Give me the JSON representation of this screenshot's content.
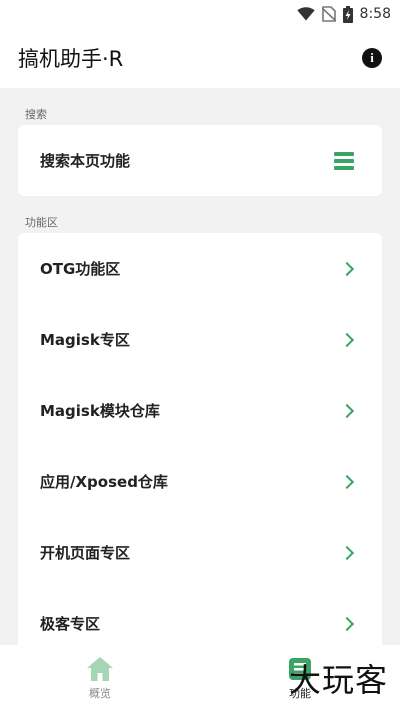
{
  "status_bar": {
    "time": "8:58",
    "icons": [
      "wifi-icon",
      "no-sim-icon",
      "battery-charging-icon"
    ]
  },
  "app_bar": {
    "title": "搞机助手·R",
    "info_icon": "info-icon"
  },
  "search_section": {
    "label": "搜索",
    "item_label": "搜索本页功能",
    "item_icon": "menu-icon"
  },
  "features_section": {
    "label": "功能区",
    "items": [
      {
        "label": "OTG功能区"
      },
      {
        "label": "Magisk专区"
      },
      {
        "label": "Magisk模块仓库"
      },
      {
        "label": "应用/Xposed仓库"
      },
      {
        "label": "开机页面专区"
      },
      {
        "label": "极客专区"
      }
    ]
  },
  "bottom_nav": {
    "items": [
      {
        "label": "概览",
        "icon": "home-icon",
        "active": false
      },
      {
        "label": "功能",
        "icon": "feature-icon",
        "active": true
      }
    ]
  },
  "watermark": "大玩客",
  "colors": {
    "accent": "#3ba464",
    "inactive_icon": "#a5d6b4",
    "background": "#f2f2f2"
  }
}
